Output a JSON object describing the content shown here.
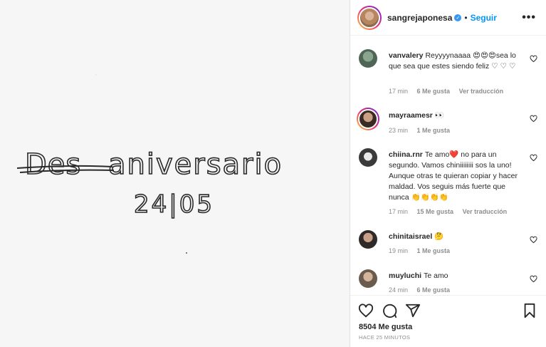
{
  "post": {
    "image_text": {
      "line1_struck": "Des",
      "line1_rest": "aniversario",
      "line2": "24|05"
    },
    "header": {
      "username": "sangrejaponesa",
      "separator": "•",
      "follow_label": "Seguir",
      "more_label": "•••"
    },
    "comments": [
      {
        "user": "vanvalery",
        "text": "Reyyyynaaaa 😍😍😍sea lo que sea que estes siendo feliz ♡ ♡ ♡",
        "time": "17 min",
        "likes": "6 Me gusta",
        "translate": "Ver traducción"
      },
      {
        "user": "mayraamesr",
        "text": "👀",
        "time": "23 min",
        "likes": "1 Me gusta",
        "translate": ""
      },
      {
        "user": "chiina.rnr",
        "text": "Te amo❤️ no para un segundo. Vamos chiniiiiiiii sos la uno! Aunque otras te quieran copiar y hacer maldad. Vos seguis más fuerte que nunca 👏👏👏👏",
        "time": "17 min",
        "likes": "15 Me gusta",
        "translate": "Ver traducción"
      },
      {
        "user": "chinitaisrael",
        "text": "🤔",
        "time": "19 min",
        "likes": "1 Me gusta",
        "translate": ""
      },
      {
        "user": "muyluchi",
        "text": "Te amo",
        "time": "24 min",
        "likes": "6 Me gusta",
        "translate": ""
      }
    ],
    "likes_count": "8504 Me gusta",
    "posted_ago": "HACE 25 MINUTOS",
    "colors": {
      "link": "#0095f6",
      "verified": "#3897f0",
      "heart": "#ed4956"
    }
  }
}
